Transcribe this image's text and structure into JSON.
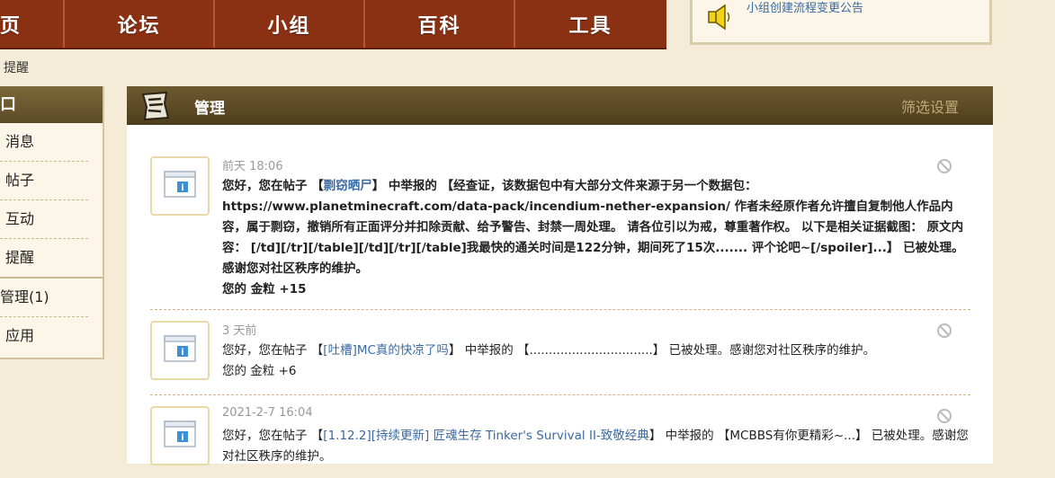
{
  "nav": {
    "items": [
      "页",
      "论坛",
      "小组",
      "百科",
      "工具"
    ]
  },
  "notice": {
    "text": "小组创建流程变更公告"
  },
  "breadcrumb": "提醒",
  "sidebar": {
    "header": "口",
    "items": [
      "消息",
      "帖子",
      "互动",
      "提醒",
      "管理(1)",
      "应用"
    ]
  },
  "panel": {
    "title": "管理",
    "filter_label": "筛选设置"
  },
  "notifications": [
    {
      "time": "前天 18:06",
      "pre": "您好，您在帖子 【",
      "link": "剽窃晒尸",
      "mid": "】 中举报的 【经查证，该数据包中有大部分文件来源于另一个数据包： https://www.planetminecraft.com/data-pack/incendium-nether-expansion/ 作者未经原作者允许擅自复制他人作品内容，属于剽窃，撤销所有正面评分并扣除贡献、给予警告、封禁一周处理。 请各位引以为戒，尊重著作权。 以下是相关证据截图： 原文内容： [/td][/tr][/table][/td][/tr][/table]我最快的通关时间是122分钟，期间死了15次....... 评个论吧~[/spoiler]...】 已被处理。感谢您对社区秩序的维护。",
      "reward": "您的 金粒 +15"
    },
    {
      "time": "3 天前",
      "pre": "您好，您在帖子 【",
      "link": "[吐槽]MC真的快凉了吗",
      "mid": "】 中举报的 【................................】 已被处理。感谢您对社区秩序的维护。",
      "reward": "您的 金粒 +6"
    },
    {
      "time": "2021-2-7 16:04",
      "pre": "您好，您在帖子 【",
      "link": "[1.12.2][持续更新] 匠魂生存 Tinker's Survival II-致敬经典",
      "mid": "】 中举报的 【MCBBS有你更精彩~...】 已被处理。感谢您对社区秩序的维护。",
      "reward": ""
    }
  ]
}
